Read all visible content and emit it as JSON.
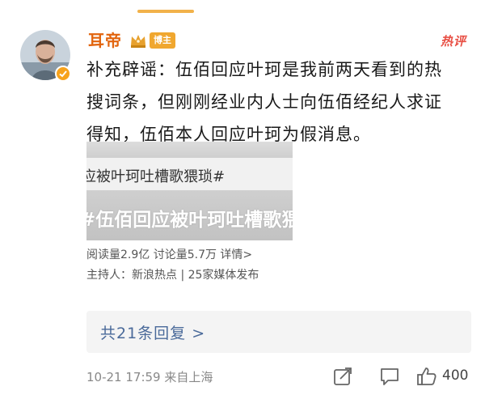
{
  "comment": {
    "username": "耳帝",
    "role_badge": "博主",
    "hot_label": "热评",
    "body_lines": [
      "补充辟谣：伍佰回应叶珂是我前两天看到的热",
      "搜词条，但刚刚经业内人士向伍佰经纪人求证",
      "得知，伍佰本人回应叶珂为假消息。"
    ],
    "topic_card": {
      "headline_small": "应被叶珂吐槽歌猥琐#",
      "headline_large": "#伍佰回应被叶珂吐槽歌猥琐",
      "stats_line": "阅读量2.9亿   讨论量5.7万   详情>",
      "host_line": "主持人：新浪热点 | 25家媒体发布"
    },
    "reply_link": "共21条回复 >",
    "timestamp_location": "10-21 17:59  来自上海",
    "like_count": "400"
  },
  "colors": {
    "username": "#e2650f",
    "hot_label": "#e84f44",
    "reply_link": "#4a6a9a",
    "accent_handle": "#f2b24a"
  },
  "icons": {
    "verified": "verified-badge-icon",
    "crown": "crown-icon",
    "share": "share-icon",
    "comment": "comment-icon",
    "like": "thumbs-up-icon"
  }
}
